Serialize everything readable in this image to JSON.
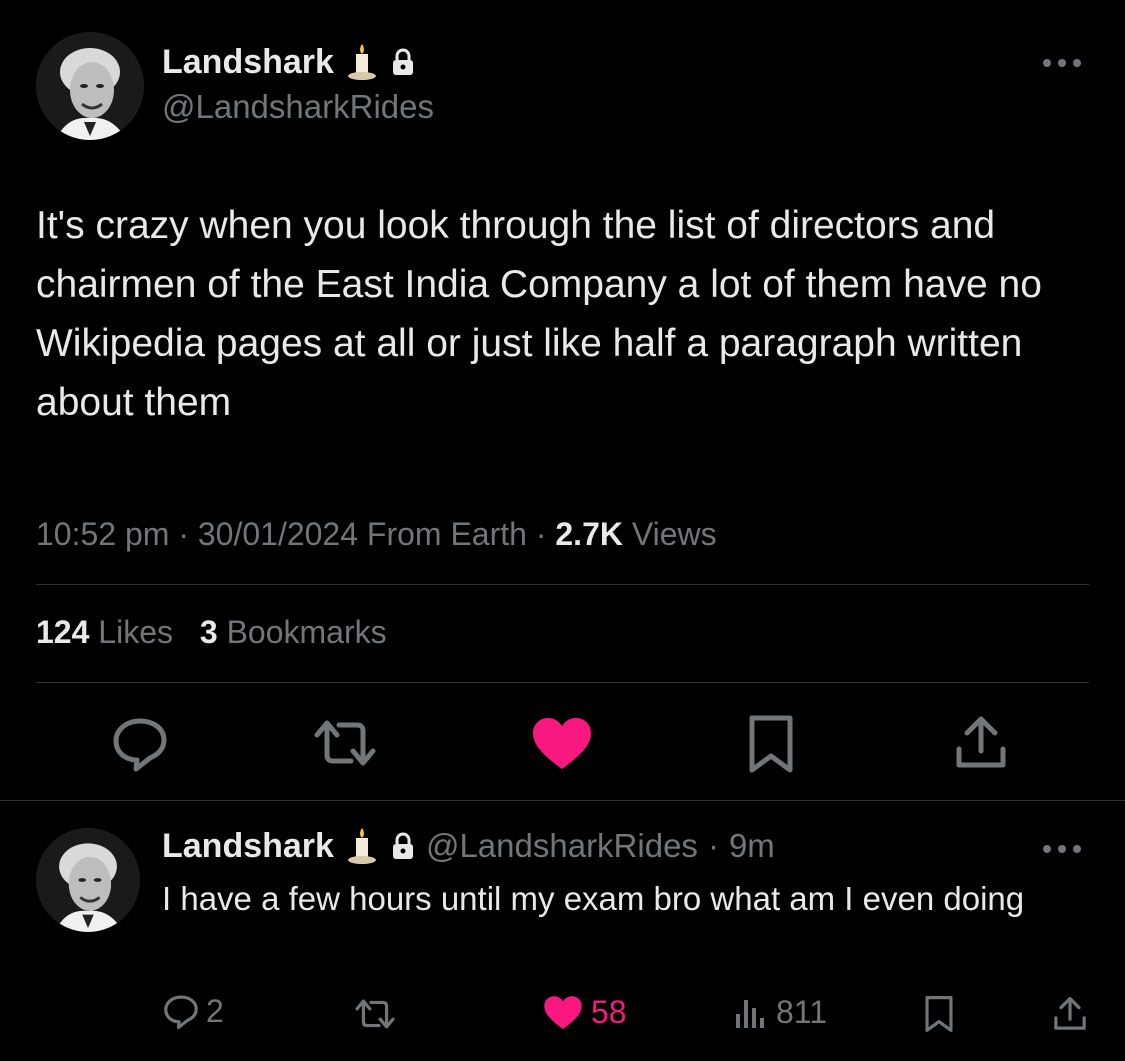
{
  "main_tweet": {
    "author_name": "Landshark",
    "author_handle": "@LandsharkRides",
    "text": "It's crazy when you look through the list of directors and chairmen of the East India Company a lot of them have no Wikipedia pages at all or just like half a paragraph written about them",
    "time": "10:52 pm",
    "separator": "·",
    "date": "30/01/2024",
    "source": "From Earth",
    "views_count": "2.7K",
    "views_label": "Views",
    "likes_count": "124",
    "likes_label": "Likes",
    "bookmarks_count": "3",
    "bookmarks_label": "Bookmarks",
    "liked": true
  },
  "reply": {
    "author_name": "Landshark",
    "author_handle": "@LandsharkRides",
    "separator": "·",
    "time_ago": "9m",
    "text": "I have a few hours until my exam bro what am I even doing",
    "replies": "2",
    "likes": "58",
    "views": "811",
    "liked": true
  },
  "colors": {
    "background": "#000000",
    "text": "#e7e9ea",
    "secondary": "#71767b",
    "like": "#f91880",
    "divider": "#2f3336"
  },
  "icons": [
    "candle-emoji-icon",
    "lock-icon",
    "more-icon",
    "reply-icon",
    "retweet-icon",
    "heart-icon",
    "bookmark-icon",
    "share-icon",
    "views-icon"
  ]
}
